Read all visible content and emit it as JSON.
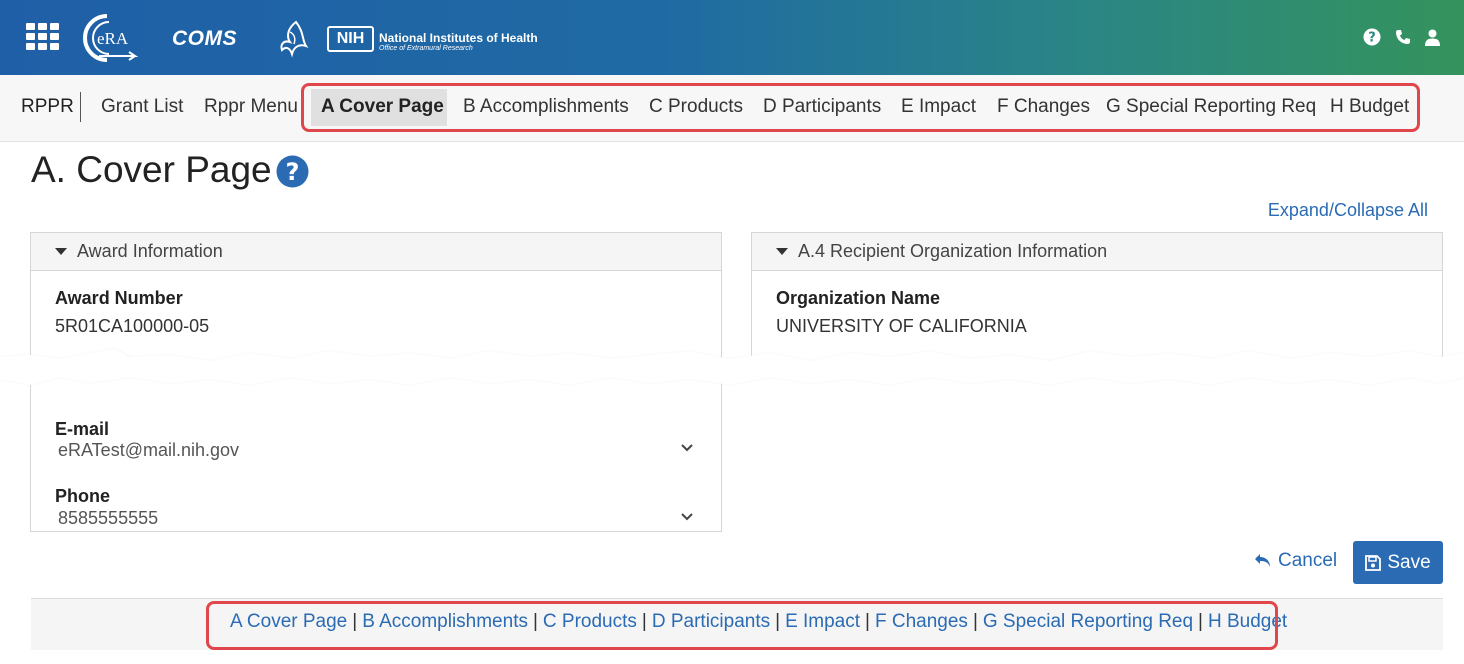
{
  "header": {
    "app_name": "COMS",
    "era_logo_text": "eRA",
    "nih_abbrev": "NIH",
    "nih_name": "National Institutes of Health",
    "nih_office": "Office of Extramural Research",
    "gradient_colors": [
      "#1f5fa7",
      "#34935c"
    ]
  },
  "nav": {
    "module": "RPPR",
    "links": [
      "Grant List",
      "Rppr Menu"
    ],
    "sections": [
      "A Cover Page",
      "B Accomplishments",
      "C Products",
      "D Participants",
      "E Impact",
      "F Changes",
      "G Special Reporting Req",
      "H Budget"
    ],
    "active_section": "A Cover Page"
  },
  "page": {
    "title": "A. Cover Page",
    "expand_collapse": "Expand/Collapse All"
  },
  "award_panel": {
    "title": "Award Information",
    "award_number_label": "Award Number",
    "award_number_value": "5R01CA100000-05",
    "email_label": "E-mail",
    "email_value": "eRATest@mail.nih.gov",
    "phone_label": "Phone",
    "phone_value": "8585555555"
  },
  "org_panel": {
    "title": "A.4 Recipient Organization Information",
    "org_name_label": "Organization Name",
    "org_name_value": "UNIVERSITY OF CALIFORNIA"
  },
  "actions": {
    "cancel": "Cancel",
    "save": "Save"
  },
  "footer": {
    "sections": [
      "A Cover Page",
      "B Accomplishments",
      "C Products",
      "D Participants",
      "E Impact",
      "F Changes",
      "G Special Reporting Req",
      "H Budget"
    ]
  },
  "colors": {
    "link": "#2a6bb4",
    "highlight": "#e0474c",
    "save_button": "#2a6bb4"
  }
}
